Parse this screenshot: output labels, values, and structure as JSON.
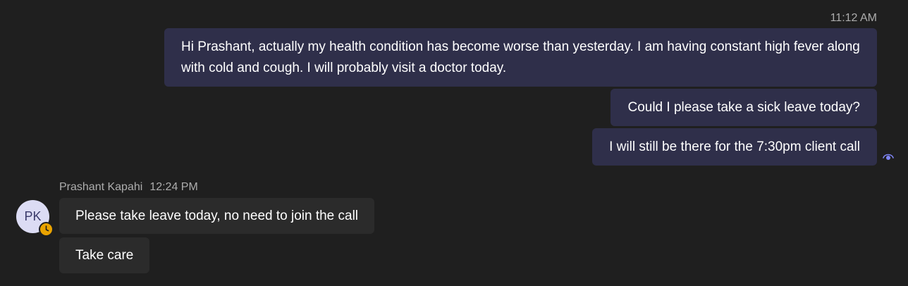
{
  "conversation": {
    "my_messages": {
      "timestamp": "11:12 AM",
      "items": [
        {
          "text": "Hi Prashant, actually my health condition has become worse than yesterday. I am having constant high fever along with cold and cough. I will probably visit a doctor today."
        },
        {
          "text": "Could I please take a sick leave today?"
        },
        {
          "text": "I will still be there for the 7:30pm client call"
        }
      ],
      "read_receipt_icon": "seen-eye-icon"
    },
    "their_messages": {
      "sender_name": "Prashant Kapahi",
      "timestamp": "12:24 PM",
      "avatar_initials": "PK",
      "presence_status_icon": "away-clock-icon",
      "items": [
        {
          "text": "Please take leave today, no need to join the call"
        },
        {
          "text": "Take care"
        }
      ]
    }
  },
  "colors": {
    "background": "#1f1f1f",
    "my_bubble": "#2f2f4a",
    "their_bubble": "#2b2b2b",
    "meta_text": "#adadad",
    "avatar_bg": "#dcdcf4",
    "away_status": "#eaa300",
    "read_receipt": "#7f85f5"
  }
}
